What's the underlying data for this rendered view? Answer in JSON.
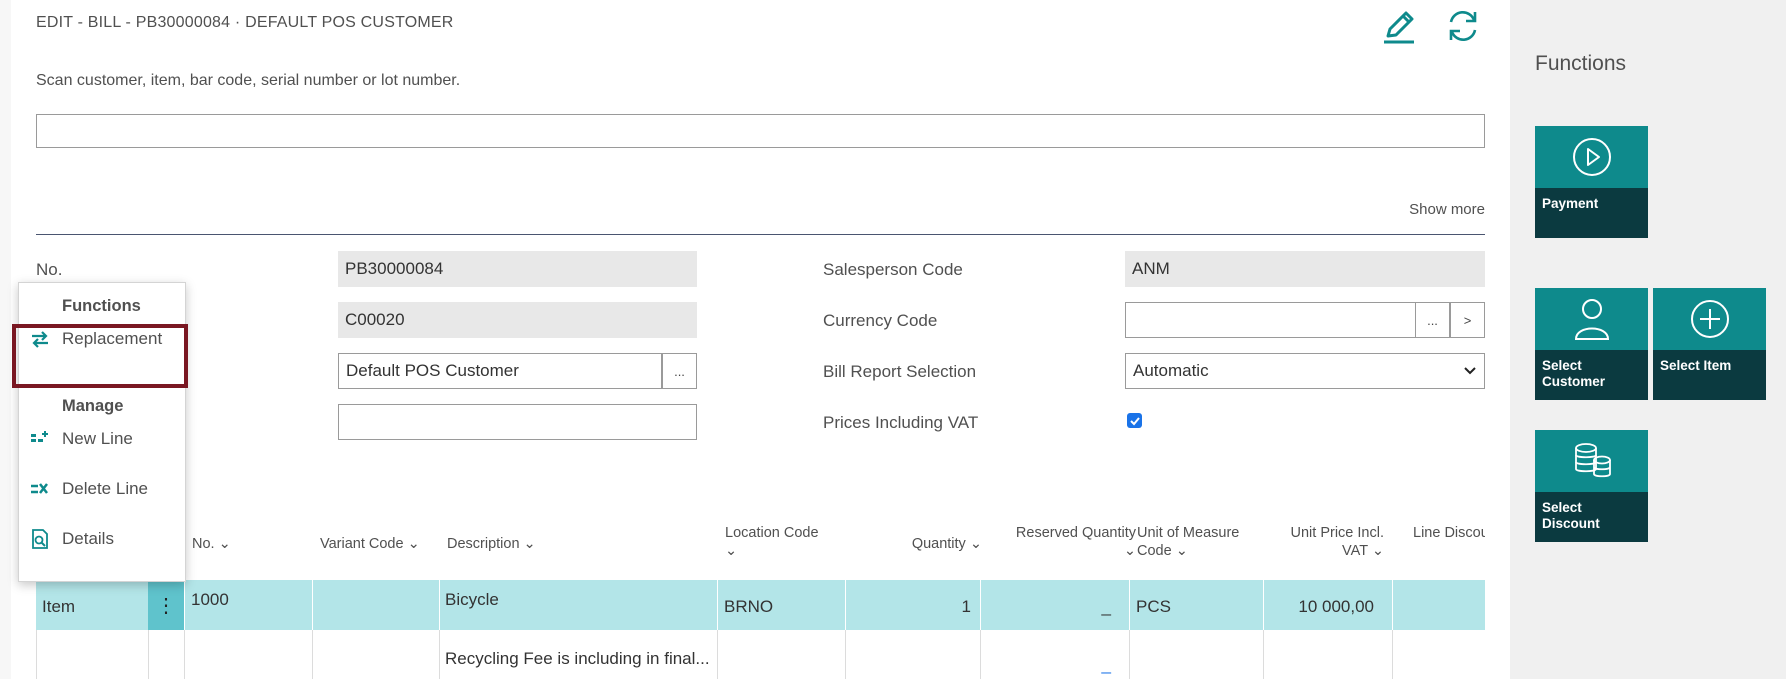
{
  "header": {
    "title": "EDIT - BILL - PB30000084 · DEFAULT POS CUSTOMER",
    "edit_icon": "pencil-icon",
    "refresh_icon": "refresh-icon"
  },
  "scan": {
    "label": "Scan customer, item, bar code, serial number or lot number.",
    "value": "",
    "show_more": "Show more"
  },
  "fields": {
    "no_label": "No.",
    "no_value": "PB30000084",
    "customer_no_value": "C00020",
    "customer_name_value": "Default POS Customer",
    "extra_value": "",
    "salesperson_label": "Salesperson Code",
    "salesperson_value": "ANM",
    "currency_label": "Currency Code",
    "currency_value": "",
    "ellipsis": "...",
    "forward": ">",
    "bill_report_label": "Bill Report Selection",
    "bill_report_value": "Automatic",
    "prices_vat_label": "Prices Including VAT",
    "prices_vat_checked": true
  },
  "table": {
    "headers": {
      "no": "No.",
      "variant": "Variant Code",
      "description": "Description",
      "location_1": "Location Code",
      "quantity": "Quantity",
      "reserved": "Reserved Quantity",
      "uom_1": "Unit of Measure",
      "uom_2": "Code",
      "price_1": "Unit Price Incl.",
      "price_2": "VAT",
      "line_discount": "Line Discou"
    },
    "rows": [
      {
        "type": "Item",
        "no": "1000",
        "variant": "",
        "description": "Bicycle",
        "location": "BRNO",
        "quantity": "1",
        "reserved": "_",
        "uom": "PCS",
        "price": "10 000,00",
        "discount": ""
      },
      {
        "type": "",
        "no": "",
        "variant": "",
        "description": "Recycling Fee is including in final...",
        "location": "",
        "quantity": "",
        "reserved": "_",
        "uom": "",
        "price": "",
        "discount": ""
      }
    ]
  },
  "context_menu": {
    "functions_heading": "Functions",
    "replacement": "Replacement",
    "manage_heading": "Manage",
    "new_line": "New Line",
    "delete_line": "Delete Line",
    "details": "Details"
  },
  "functions_panel": {
    "title": "Functions",
    "tiles": {
      "payment": "Payment",
      "select_customer": "Select Customer",
      "select_item": "Select Item",
      "select_discount": "Select Discount"
    }
  },
  "colors": {
    "accent": "#0e8a8c",
    "tile_bottom": "#0b3a40",
    "row_selected": "#b3e5e8",
    "highlight_border": "#7a1722"
  }
}
